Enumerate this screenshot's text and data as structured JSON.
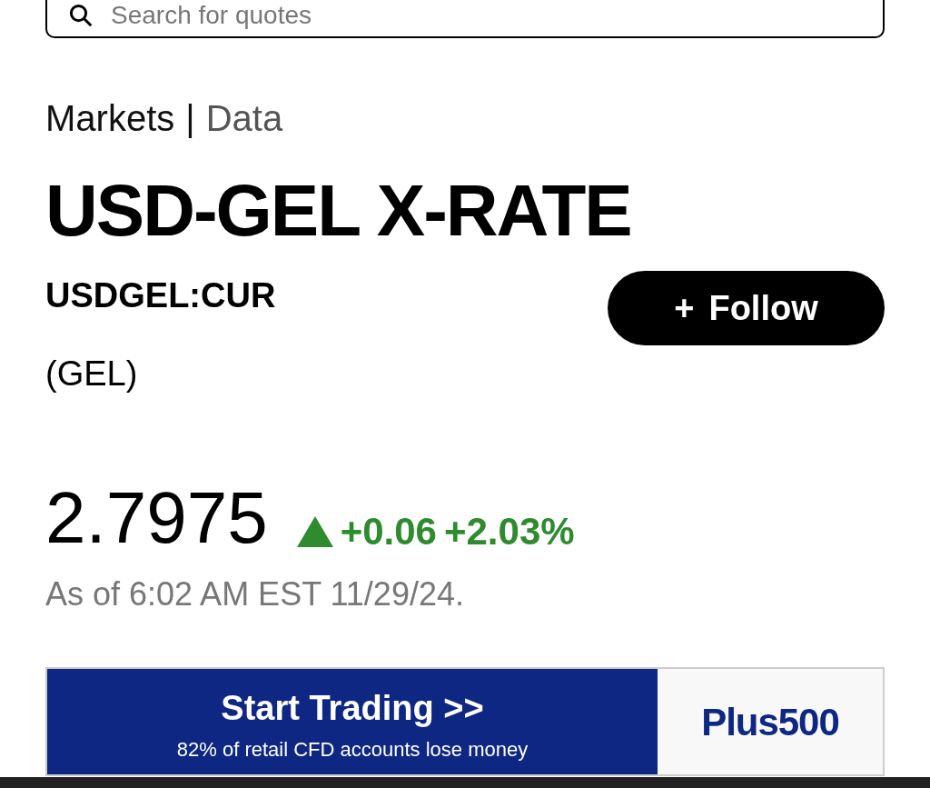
{
  "search": {
    "placeholder": "Search for quotes"
  },
  "breadcrumb": {
    "section": "Markets",
    "separator": "|",
    "subsection": "Data"
  },
  "title": "USD-GEL X-RATE",
  "ticker": "USDGEL:CUR",
  "follow_button": {
    "icon": "+",
    "label": "Follow"
  },
  "currency": "(GEL)",
  "quote": {
    "price": "2.7975",
    "rising": true,
    "change": "+0.06",
    "change_percent": "+2.03%",
    "timestamp": "As of 6:02 AM EST 11/29/24."
  },
  "ad": {
    "headline": "Start Trading >>",
    "disclaimer": "82% of retail CFD accounts lose money",
    "brand": "Plus500"
  }
}
